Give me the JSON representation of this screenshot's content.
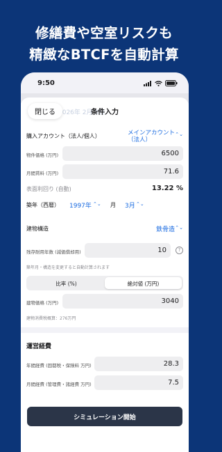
{
  "headline": {
    "line1": "修繕費や空室リスクも",
    "line2": "精緻なBTCFを自動計算"
  },
  "status": {
    "time": "9:50"
  },
  "sheet": {
    "close": "閉じる",
    "background_text": "2026年 2月 3日",
    "title": "条件入力"
  },
  "form": {
    "account_label": "購入アカウント（法人/個人）",
    "account_value": "メインアカウント\n（法人）",
    "price_label": "物件価格 (万円)",
    "price_value": "6500",
    "rent_label": "月間賃料 (万円)",
    "rent_value": "71.6",
    "yield_label": "表面利回り (自動)",
    "yield_value": "13.22 %",
    "built_label": "築年（西暦）",
    "built_year": "1997年",
    "month_label": "月",
    "built_month": "3月",
    "structure_label": "建物構造",
    "structure_value": "鉄骨造",
    "life_label": "残存耐用年数 (減価償却用)",
    "life_value": "10",
    "help": "?",
    "life_note": "築年月・構造を変更すると自動計算されます",
    "seg_ratio": "比率 (%)",
    "seg_absolute": "絶対値 (万円)",
    "building_label": "建物価格 (万円)",
    "building_value": "3040",
    "tax_note": "建物消費税概算：276万円"
  },
  "opex": {
    "title": "運営経費",
    "annual_label": "年間経費 (固都税・保険料 万円)",
    "annual_value": "28.3",
    "monthly_label": "月間経費 (管理費・諸経費 万円)",
    "monthly_value": "7.5"
  },
  "start_button": "シミュレーション開始"
}
